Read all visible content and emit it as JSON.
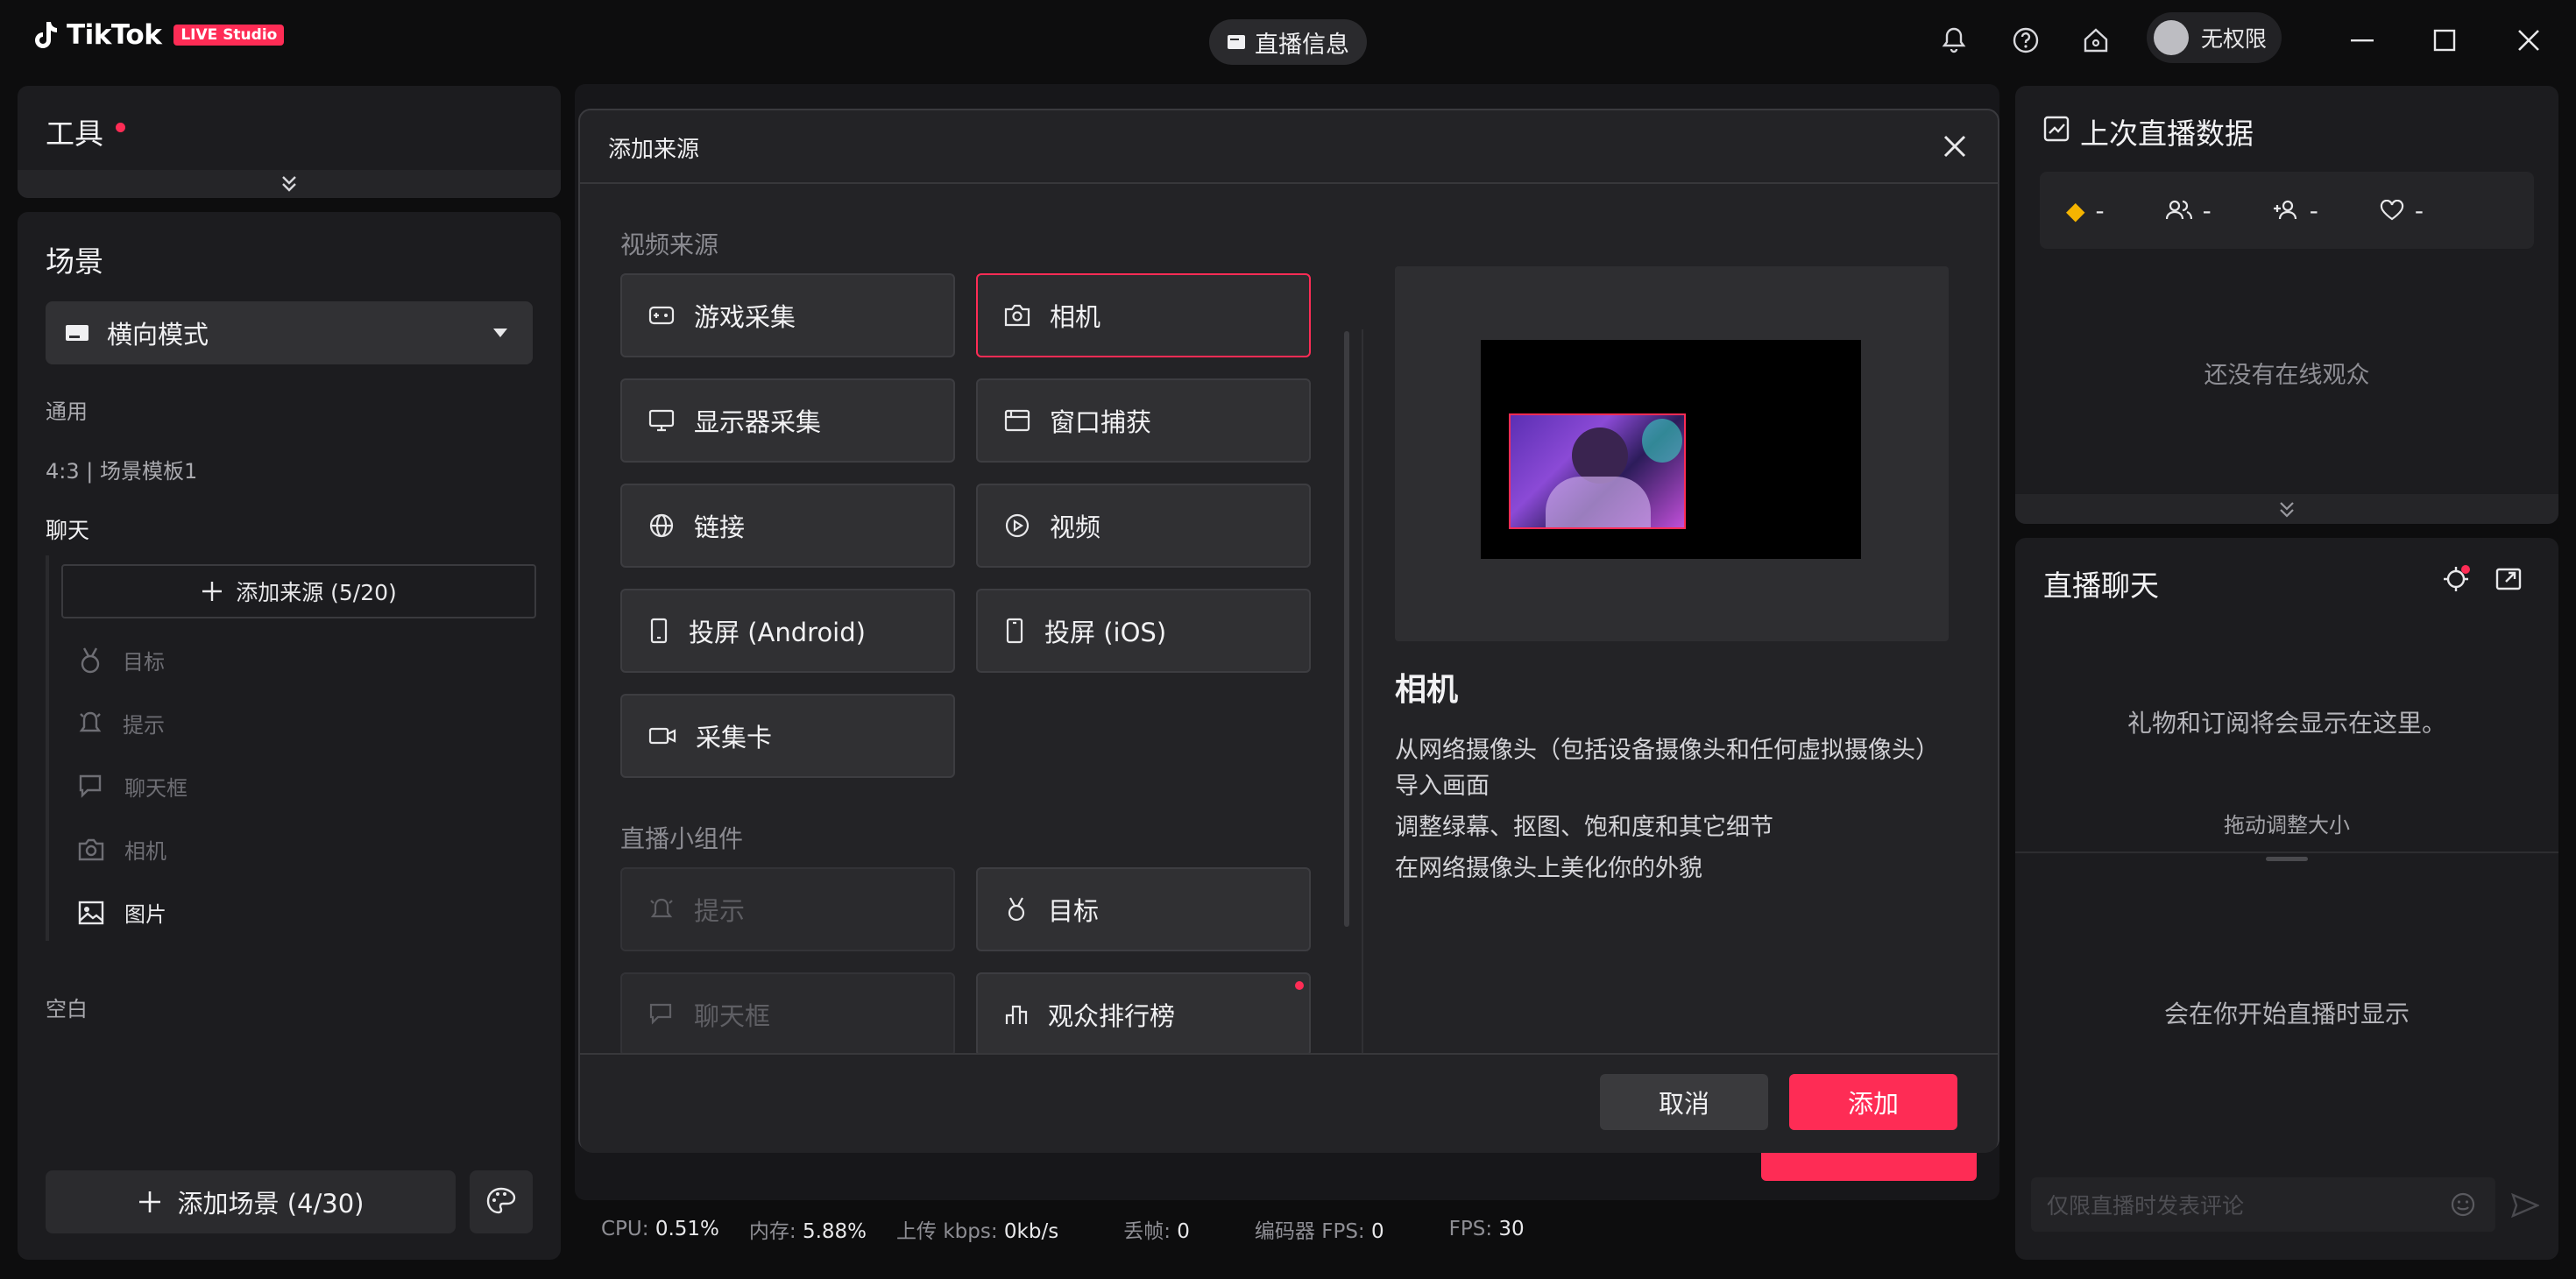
{
  "app": {
    "brand": "TikTok",
    "badge": "LIVE Studio",
    "center_button": "直播信息",
    "user_name": "无权限"
  },
  "tools": {
    "title": "工具"
  },
  "scene": {
    "title": "场景",
    "mode": "横向模式",
    "section_general": "通用",
    "template": "4:3 | 场景模板1",
    "section_chat": "聊天",
    "add_source": "添加来源 (5/20)",
    "items": [
      "目标",
      "提示",
      "聊天框",
      "相机",
      "图片"
    ],
    "section_blank": "空白",
    "add_scene": "添加场景 (4/30)"
  },
  "last_stream": {
    "title": "上次直播数据",
    "stats": [
      "-",
      "-",
      "-",
      "-"
    ],
    "empty": "还没有在线观众"
  },
  "chat": {
    "title": "直播聊天",
    "gifts_msg": "礼物和订阅将会显示在这里。",
    "resize": "拖动调整大小",
    "start_msg": "会在你开始直播时显示",
    "input_placeholder": "仅限直播时发表评论"
  },
  "stats_bar": {
    "cpu_label": "CPU:",
    "cpu": "0.51%",
    "mem_label": "内存:",
    "mem": "5.88%",
    "upload_label": "上传 kbps:",
    "upload": "0kb/s",
    "drop_label": "丢帧:",
    "drop": "0",
    "enc_label": "编码器 FPS:",
    "enc": "0",
    "fps_label": "FPS:",
    "fps": "30"
  },
  "modal": {
    "title": "添加来源",
    "video_section": "视频来源",
    "video_sources": [
      "游戏采集",
      "相机",
      "显示器采集",
      "窗口捕获",
      "链接",
      "视频",
      "投屏 (Android)",
      "投屏 (iOS)",
      "采集卡"
    ],
    "widget_section": "直播小组件",
    "widgets": [
      "提示",
      "目标",
      "聊天框",
      "观众排行榜"
    ],
    "preview_title": "相机",
    "preview_desc": [
      "从网络摄像头（包括设备摄像头和任何虚拟摄像头）导入画面",
      "调整绿幕、抠图、饱和度和其它细节",
      "在网络摄像头上美化你的外貌"
    ],
    "cancel": "取消",
    "add": "添加"
  },
  "colors": {
    "accent": "#fe2c55",
    "bg": "#0d0d0e",
    "panel": "#1c1c1f"
  }
}
